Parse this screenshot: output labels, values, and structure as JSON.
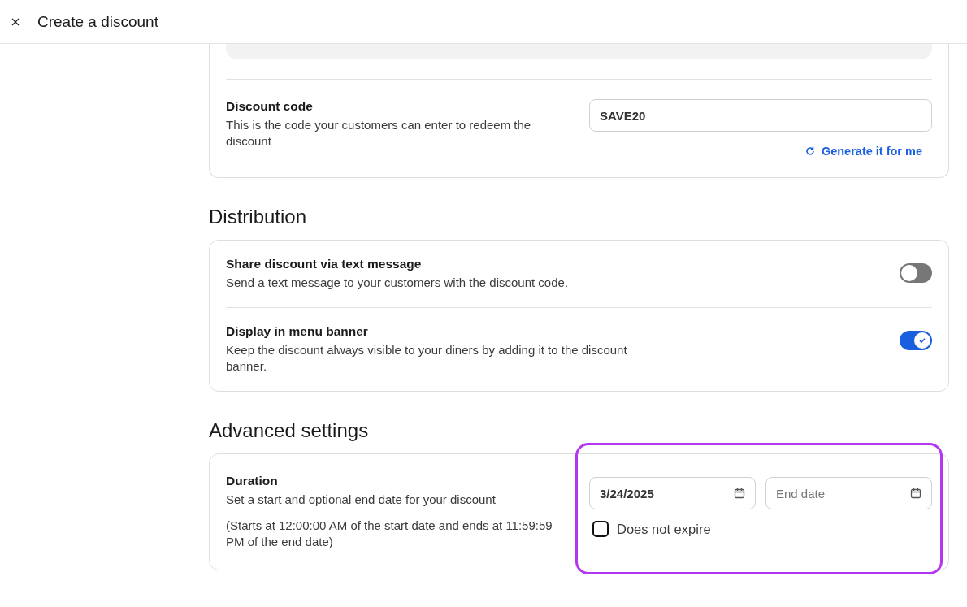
{
  "header": {
    "title": "Create a discount"
  },
  "code_section": {
    "label": "Discount code",
    "description": "This is the code your customers can enter to redeem the discount",
    "value": "SAVE20",
    "generate_link": "Generate it for me"
  },
  "distribution": {
    "title": "Distribution",
    "toggles": [
      {
        "label": "Share discount via text message",
        "description": "Send a text message to your customers with the discount code.",
        "on": false
      },
      {
        "label": "Display in menu banner",
        "description": "Keep the discount always visible to your diners by adding it to the discount banner.",
        "on": true
      }
    ]
  },
  "advanced": {
    "title": "Advanced settings",
    "duration": {
      "label": "Duration",
      "description": "Set a start and optional end date for your discount",
      "note": "(Starts at 12:00:00 AM of the start date and ends at 11:59:59 PM of the end date)",
      "start_date": {
        "value": "3/24/2025"
      },
      "end_date": {
        "placeholder": "End date"
      },
      "does_not_expire": {
        "label": "Does not expire",
        "checked": false
      },
      "highlighted": true
    }
  }
}
